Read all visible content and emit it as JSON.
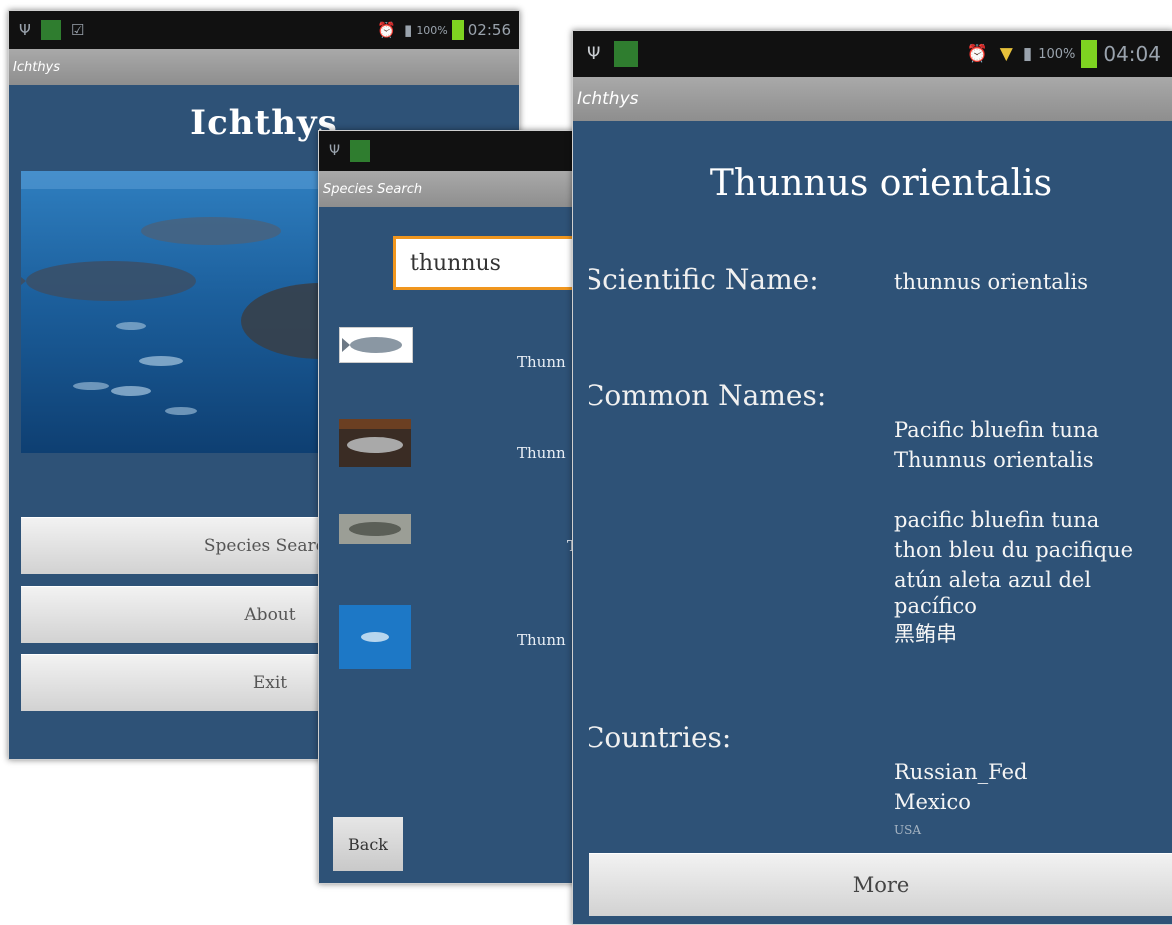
{
  "status_left": {
    "time": "02:56",
    "battery": "100%"
  },
  "status_right": {
    "time": "04:04",
    "battery": "100%"
  },
  "main_screen": {
    "titlebar": "Ichthys",
    "app_name": "Ichthys",
    "buttons": [
      "Species Search",
      "About",
      "Exit"
    ]
  },
  "search_screen": {
    "titlebar": "Species Search",
    "query": "thunnus",
    "results": [
      "Thunn",
      "Thunn",
      "T",
      "Thunn"
    ],
    "back_label": "Back"
  },
  "detail_screen": {
    "titlebar": "Ichthys",
    "heading": "Thunnus orientalis",
    "scientific_label": "Scientific Name:",
    "scientific_value": "thunnus orientalis",
    "common_label": "Common Names:",
    "common_names_1": "Pacific bluefin tuna",
    "common_names_2": "Thunnus orientalis",
    "common_names_3": "pacific bluefin tuna",
    "common_names_4": "thon bleu du pacifique",
    "common_names_5": "atún aleta azul del",
    "common_names_6": "pacífico",
    "common_names_7": "黑鲔串",
    "countries_label": "Countries:",
    "country_1": "Russian_Fed",
    "country_2": "Mexico",
    "country_3": "USA",
    "more_label": "More"
  },
  "colors": {
    "app_bg": "#2e5277",
    "accent": "#f0961e"
  }
}
